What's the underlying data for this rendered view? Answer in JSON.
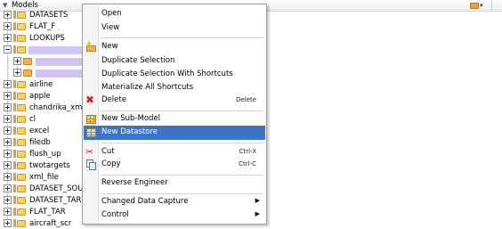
{
  "header": {
    "title": "Models"
  },
  "tree": {
    "items": [
      {
        "label": "DATASETS",
        "expanded": false,
        "type": "model"
      },
      {
        "label": "FLAT_F",
        "expanded": false,
        "type": "model"
      },
      {
        "label": "LOOKUPS",
        "expanded": false,
        "type": "model"
      },
      {
        "label": "",
        "expanded": true,
        "type": "model",
        "redacted": true
      },
      {
        "label": "",
        "expanded": false,
        "type": "sub",
        "redacted": true
      },
      {
        "label": "",
        "expanded": false,
        "type": "sub",
        "redacted": true
      },
      {
        "label": "airline",
        "expanded": false,
        "type": "model"
      },
      {
        "label": "apple",
        "expanded": false,
        "type": "model"
      },
      {
        "label": "chandrika_xml",
        "expanded": false,
        "type": "model"
      },
      {
        "label": "cl",
        "expanded": false,
        "type": "model"
      },
      {
        "label": "excel",
        "expanded": false,
        "type": "model"
      },
      {
        "label": "filedb",
        "expanded": false,
        "type": "model"
      },
      {
        "label": "flush_up",
        "expanded": false,
        "type": "model"
      },
      {
        "label": "twotargets",
        "expanded": false,
        "type": "model"
      },
      {
        "label": "xml_file",
        "expanded": false,
        "type": "model"
      },
      {
        "label": "DATASET_SOUR",
        "expanded": false,
        "type": "model"
      },
      {
        "label": "DATASET_TARG",
        "expanded": false,
        "type": "model"
      },
      {
        "label": "FLAT_TAR",
        "expanded": false,
        "type": "model"
      },
      {
        "label": "aircraft_scr",
        "expanded": false,
        "type": "model"
      }
    ]
  },
  "menu": {
    "items": [
      {
        "label": "Open",
        "accel": "",
        "icon": "",
        "submenu": false
      },
      {
        "label": "View",
        "accel": "",
        "icon": "",
        "submenu": false
      },
      {
        "label": "New",
        "accel": "",
        "icon": "new-folder-icon",
        "submenu": false
      },
      {
        "label": "Duplicate Selection",
        "accel": "",
        "icon": "",
        "submenu": false
      },
      {
        "label": "Duplicate Selection With Shortcuts",
        "accel": "",
        "icon": "",
        "submenu": false
      },
      {
        "label": "Materialize All Shortcuts",
        "accel": "",
        "icon": "",
        "submenu": false
      },
      {
        "label": "Delete",
        "accel": "Delete",
        "icon": "delete-x-icon",
        "submenu": false
      },
      {
        "label": "New Sub-Model",
        "accel": "",
        "icon": "sub-model-icon",
        "submenu": false
      },
      {
        "label": "New Datastore",
        "accel": "",
        "icon": "datastore-icon",
        "submenu": false,
        "selected": true
      },
      {
        "label": "Cut",
        "accel": "Ctrl-X",
        "icon": "cut-icon",
        "submenu": false
      },
      {
        "label": "Copy",
        "accel": "Ctrl-C",
        "icon": "copy-icon",
        "submenu": false
      },
      {
        "label": "Reverse Engineer",
        "accel": "",
        "icon": "",
        "submenu": false
      },
      {
        "label": "Changed Data Capture",
        "accel": "",
        "icon": "",
        "submenu": true
      },
      {
        "label": "Control",
        "accel": "",
        "icon": "",
        "submenu": true
      }
    ]
  },
  "colors": {
    "selection": "#3d73c6",
    "redaction": "#d3c5f3"
  }
}
